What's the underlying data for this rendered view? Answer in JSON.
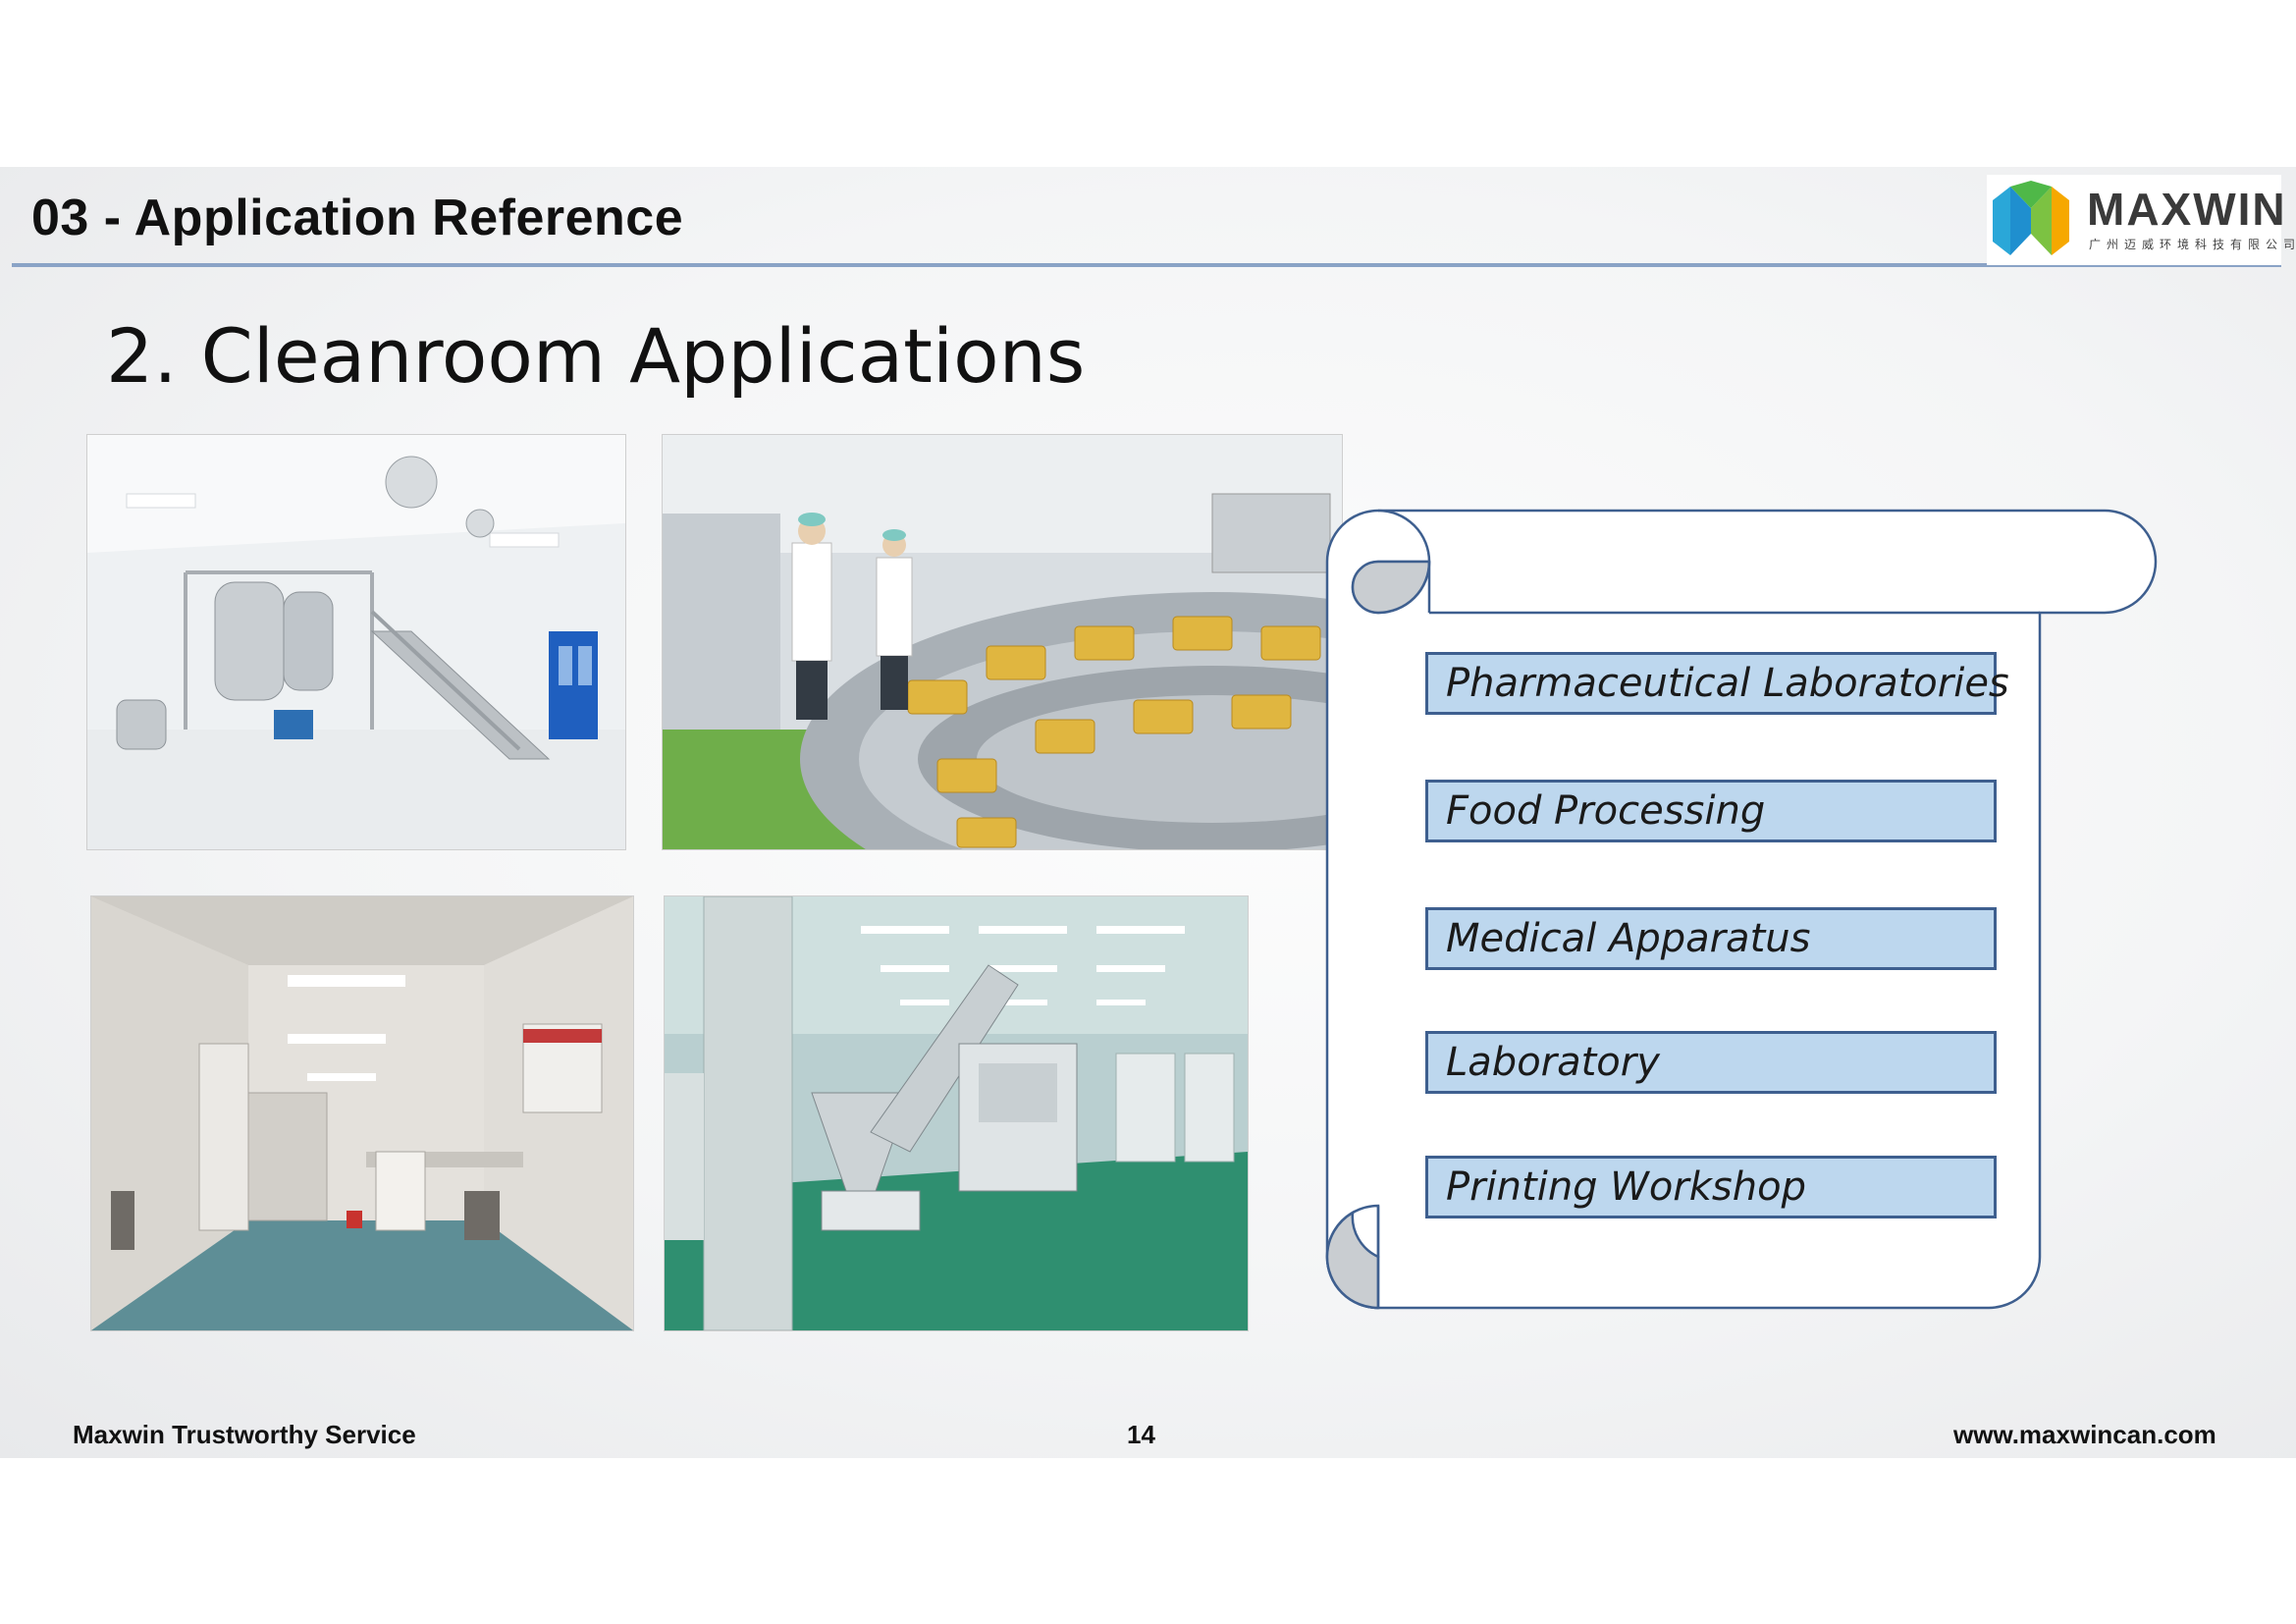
{
  "header": {
    "section_title": "03 - Application Reference",
    "logo": {
      "name": "MAXWIN",
      "subtitle": "广州迈威环境科技有限公司"
    }
  },
  "slide": {
    "title": "2. Cleanroom Applications"
  },
  "photos": [
    {
      "icon": "cleanroom-tank-staircase-photo"
    },
    {
      "icon": "food-processing-conveyor-photo"
    },
    {
      "icon": "laboratory-corridor-photo"
    },
    {
      "icon": "green-floor-equipment-photo"
    }
  ],
  "applications": [
    {
      "label": "Pharmaceutical Laboratories"
    },
    {
      "label": "Food Processing"
    },
    {
      "label": "Medical Apparatus"
    },
    {
      "label": "Laboratory"
    },
    {
      "label": "Printing Workshop"
    }
  ],
  "footer": {
    "left": "Maxwin Trustworthy Service",
    "page_number": "14",
    "url": "www.maxwincan.com"
  },
  "colors": {
    "accent_blue": "#3e5f8f",
    "item_fill": "#bdd7ee",
    "header_rule": "#8aa3c6"
  }
}
